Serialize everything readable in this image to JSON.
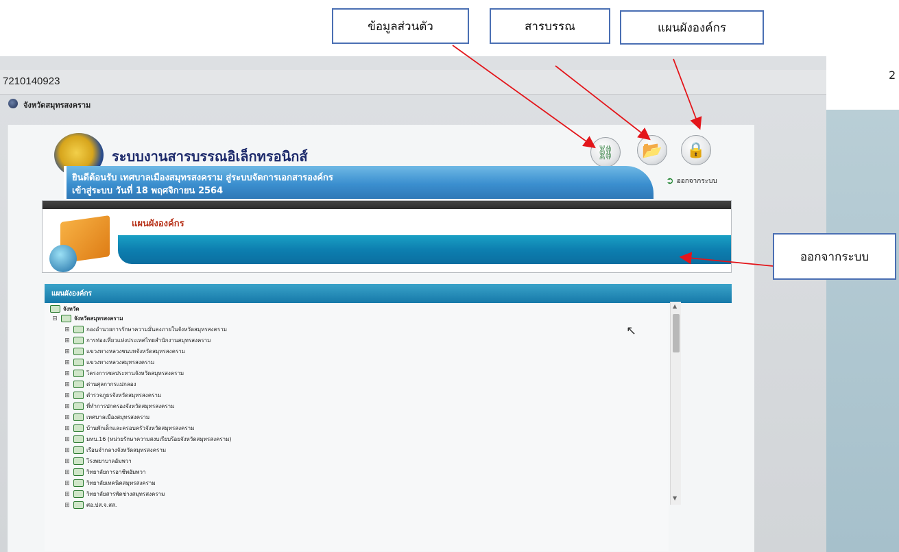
{
  "browser": {
    "address_text": "7210140923",
    "favorites_item": "จังหวัดสมุทรสงคราม"
  },
  "app": {
    "title": "ระบบงานสารบรรณอิเล็กทรอนิกส์"
  },
  "welcome": {
    "line1": "ยินดีต้อนรับ เทศบาลเมืองสมุทรสงคราม สู่ระบบจัดการเอกสารองค์กร",
    "line2": "เข้าสู่ระบบ วันที่ 18 พฤศจิกายน 2564"
  },
  "logout_link": "ออกจากระบบ",
  "section_title": "แผนผังองค์กร",
  "org_panel_header": "แผนผังองค์กร",
  "tree": {
    "root": "จังหวัด",
    "province": "จังหวัดสมุทรสงคราม",
    "children": [
      "กองอำนวยการรักษาความมั่นคงภายในจังหวัดสมุทรสงคราม",
      "การท่องเที่ยวแห่งประเทศไทยสำนักงานสมุทรสงคราม",
      "แขวงทางหลวงชนบทจังหวัดสมุทรสงคราม",
      "แขวงทางหลวงสมุทรสงคราม",
      "โครงการชลประทานจังหวัดสมุทรสงคราม",
      "ด่านศุลกากรแม่กลอง",
      "ตำรวจภูธรจังหวัดสมุทรสงคราม",
      "ที่ทำการปกครองจังหวัดสมุทรสงคราม",
      "เทศบาลเมืองสมุทรสงคราม",
      "บ้านพักเด็กและครอบครัวจังหวัดสมุทรสงคราม",
      "มทบ.16 (หน่วยรักษาความสงบเรียบร้อยจังหวัดสมุทรสงคราม)",
      "เรือนจำกลางจังหวัดสมุทรสงคราม",
      "โรงพยาบาลอัมพวา",
      "วิทยาลัยการอาชีพอัมพวา",
      "วิทยาลัยเทคนิคสมุทรสงคราม",
      "วิทยาลัยสารพัดช่างสมุทรสงคราม",
      "ศอ.ปส.จ.สส."
    ]
  },
  "annotations": {
    "personal_info": "ข้อมูลส่วนตัว",
    "saraban": "สารบรรณ",
    "org_chart": "แผนผังองค์กร",
    "logout": "ออกจากระบบ"
  },
  "page_number": "2",
  "icons": {
    "org_chart": "org-chart-icon",
    "documents": "folder-globe-icon",
    "lock": "lock-icon",
    "logout": "logout-arrow-icon",
    "cursor": "mouse-cursor-icon"
  },
  "colors": {
    "annotation_border": "#4a6fb3",
    "arrow": "#e3161b",
    "band_blue": "#0d7fb0",
    "title_blue": "#1d2a6b",
    "section_title_red": "#b8341c"
  }
}
